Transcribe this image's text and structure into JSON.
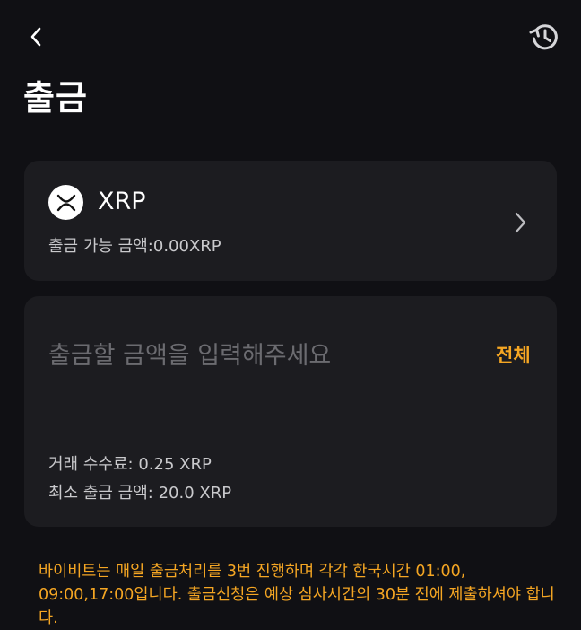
{
  "header": {
    "title": "출금",
    "back_icon": "chevron-left-icon",
    "history_icon": "history-icon"
  },
  "asset": {
    "coin_icon": "xrp-icon",
    "symbol": "XRP",
    "available_label": "출금 가능 금액:",
    "available_value": "0.00XRP"
  },
  "amount": {
    "placeholder": "출금할 금액을 입력해주세요",
    "value": "",
    "max_label": "전체"
  },
  "fees": {
    "fee_label": "거래 수수료:",
    "fee_value": "0.25 XRP",
    "min_label": "최소 출금 금액:",
    "min_value": "20.0 XRP"
  },
  "notice": "바이비트는 매일 출금처리를 3번 진행하며 각각 한국시간 01:00, 09:00,17:00입니다. 출금신청은 예상 심사시간의 30분 전에 제출하셔야 합니다.",
  "colors": {
    "background": "#101014",
    "card": "#1c1c20",
    "accent": "#f5a623",
    "placeholder": "#6b6b70"
  }
}
